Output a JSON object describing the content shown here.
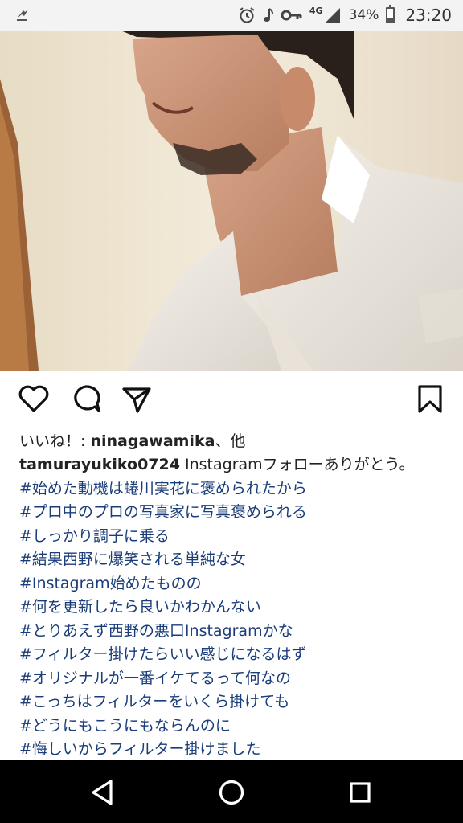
{
  "status_bar": {
    "network": "4G",
    "battery_percent": "34%",
    "battery_level": 0.34,
    "time": "23:20",
    "icons": [
      "notification-icon",
      "alarm-icon",
      "music-note-icon",
      "key-icon",
      "signal-icon",
      "battery-icon"
    ]
  },
  "post": {
    "image_alt": "photo",
    "actions": {
      "icons": [
        "heart-icon",
        "comment-icon",
        "share-icon",
        "bookmark-icon"
      ]
    },
    "likes": {
      "prefix": "いいね！: ",
      "user": "ninagawamika",
      "suffix": "、他"
    },
    "caption": {
      "user": "tamurayukiko0724",
      "text": " Instagramフォローありがとう。",
      "hashtags": [
        "#始めた動機は蜷川実花に褒められたから",
        "#プロ中のプロの写真家に写真褒められる",
        "#しっかり調子に乗る",
        "#結果西野に爆笑される単純な女",
        "#Instagram始めたものの",
        "#何を更新したら良いかわかんない",
        "#とりあえず西野の悪口Instagramかな",
        "#フィルター掛けたらいい感じになるはず",
        "#オリジナルが一番イケてるって何なの",
        "#こっちはフィルターをいくら掛けても",
        "#どうにもこうにもならんのに",
        "#悔しいからフィルター掛けました"
      ]
    }
  },
  "nav_bar": {
    "icons": [
      "back-icon",
      "home-icon",
      "recents-icon"
    ]
  }
}
